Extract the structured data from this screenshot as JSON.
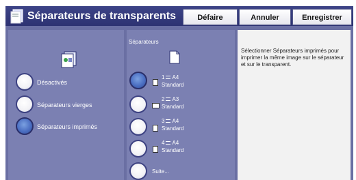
{
  "header": {
    "title": "Séparateurs de transparents",
    "title_icon": "transparency-separators-icon",
    "buttons": {
      "defaire": "Défaire",
      "annuler": "Annuler",
      "enregistrer": "Enregistrer"
    }
  },
  "left": {
    "icon": "printed-separators-icon",
    "options": [
      {
        "label": "Désactivés",
        "selected": false
      },
      {
        "label": "Séparateurs vierges",
        "selected": false
      },
      {
        "label": "Séparateurs imprimés",
        "selected": true
      }
    ]
  },
  "middle": {
    "group_label": "Séparateurs",
    "icon": "document-icon",
    "separators": [
      {
        "tray": "1",
        "size": "A4",
        "type": "Standard",
        "selected": true
      },
      {
        "tray": "2",
        "size": "A3",
        "type": "Standard",
        "selected": false
      },
      {
        "tray": "3",
        "size": "A4",
        "type": "Standard",
        "selected": false
      },
      {
        "tray": "4",
        "size": "A4",
        "type": "Standard",
        "selected": false
      }
    ],
    "more_label": "Suite..."
  },
  "help": {
    "text": "Sélectionner Séparateurs imprimés pour imprimer la même image sur le séparateur et sur le transparent."
  },
  "colors": {
    "header_bg": "#2d3272",
    "panel_bg": "#7b80b2",
    "help_bg": "#f2f2f2",
    "selected_radio": "#4c6fc2"
  }
}
